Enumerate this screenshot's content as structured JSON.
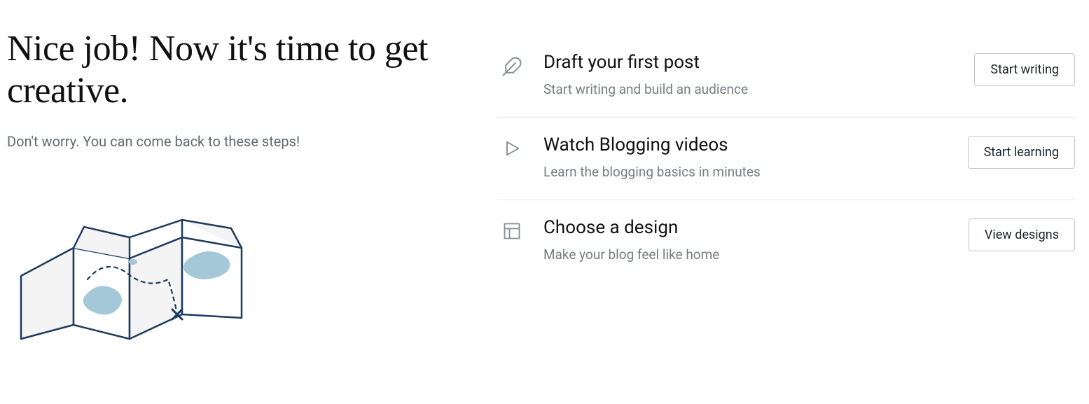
{
  "hero": {
    "headline": "Nice job! Now it's time to get creative.",
    "subhead": "Don't worry. You can come back to these steps!"
  },
  "steps": {
    "draft": {
      "title": "Draft your first post",
      "desc": "Start writing and build an audience",
      "button": "Start writing"
    },
    "watch": {
      "title": "Watch Blogging videos",
      "desc": "Learn the blogging basics in minutes",
      "button": "Start learning"
    },
    "design": {
      "title": "Choose a design",
      "desc": "Make your blog feel like home",
      "button": "View designs"
    }
  }
}
